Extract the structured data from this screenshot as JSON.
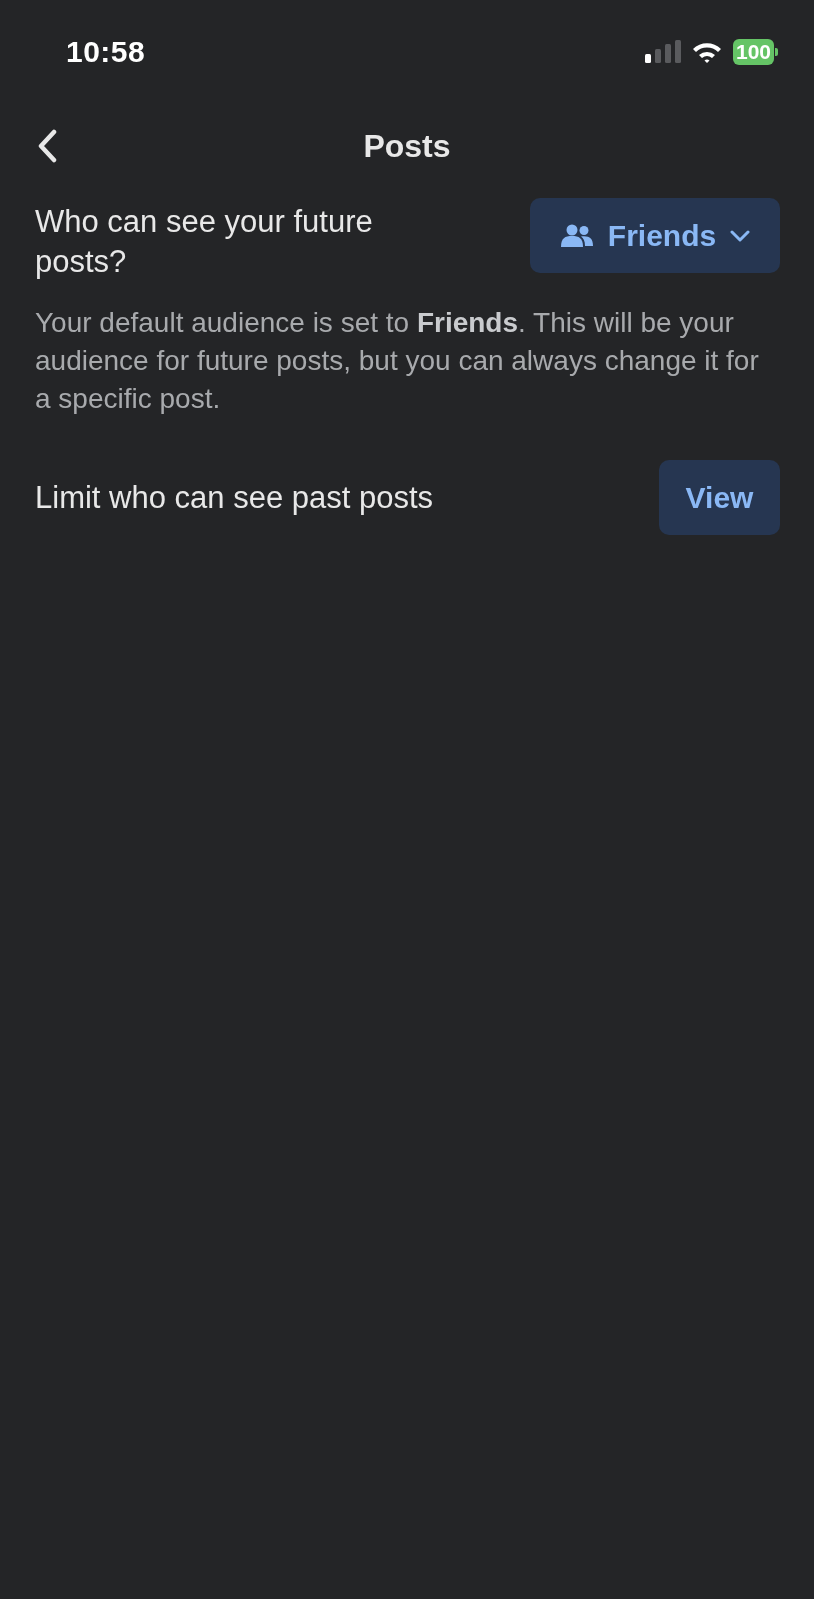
{
  "status_bar": {
    "time": "10:58",
    "battery": "100"
  },
  "header": {
    "title": "Posts"
  },
  "future_posts": {
    "question": "Who can see your future posts?",
    "audience_button": {
      "label": "Friends"
    },
    "description": "Your default audience is set to **Friends**. This will be your audience for future posts, but you can always change it for a specific post."
  },
  "past_posts": {
    "label": "Limit who can see past posts",
    "button": {
      "label": "View"
    }
  }
}
